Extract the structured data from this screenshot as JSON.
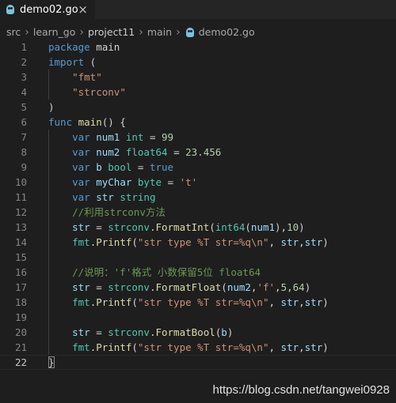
{
  "tab": {
    "filename": "demo02.go",
    "close_symbol": "×"
  },
  "breadcrumbs": [
    "src",
    "learn_go",
    "project11",
    "main",
    "demo02.go"
  ],
  "active_line": 22,
  "lines": [
    [
      [
        "k",
        "package"
      ],
      [
        "p",
        " main"
      ]
    ],
    [
      [
        "k",
        "import"
      ],
      [
        "p",
        " ("
      ]
    ],
    [
      [
        "p",
        "    "
      ],
      [
        "s",
        "\"fmt\""
      ]
    ],
    [
      [
        "p",
        "    "
      ],
      [
        "s",
        "\"strconv\""
      ]
    ],
    [
      [
        "p",
        ")"
      ]
    ],
    [
      [
        "k",
        "func"
      ],
      [
        "p",
        " "
      ],
      [
        "f",
        "main"
      ],
      [
        "p",
        "() {"
      ]
    ],
    [
      [
        "p",
        "    "
      ],
      [
        "k",
        "var"
      ],
      [
        "p",
        " "
      ],
      [
        "v",
        "num1"
      ],
      [
        "p",
        " "
      ],
      [
        "t",
        "int"
      ],
      [
        "p",
        " = "
      ],
      [
        "n",
        "99"
      ]
    ],
    [
      [
        "p",
        "    "
      ],
      [
        "k",
        "var"
      ],
      [
        "p",
        " "
      ],
      [
        "v",
        "num2"
      ],
      [
        "p",
        " "
      ],
      [
        "t",
        "float64"
      ],
      [
        "p",
        " = "
      ],
      [
        "n",
        "23.456"
      ]
    ],
    [
      [
        "p",
        "    "
      ],
      [
        "k",
        "var"
      ],
      [
        "p",
        " "
      ],
      [
        "v",
        "b"
      ],
      [
        "p",
        " "
      ],
      [
        "t",
        "bool"
      ],
      [
        "p",
        " = "
      ],
      [
        "k",
        "true"
      ]
    ],
    [
      [
        "p",
        "    "
      ],
      [
        "k",
        "var"
      ],
      [
        "p",
        " "
      ],
      [
        "v",
        "myChar"
      ],
      [
        "p",
        " "
      ],
      [
        "t",
        "byte"
      ],
      [
        "p",
        " = "
      ],
      [
        "s",
        "'t'"
      ]
    ],
    [
      [
        "p",
        "    "
      ],
      [
        "k",
        "var"
      ],
      [
        "p",
        " "
      ],
      [
        "v",
        "str"
      ],
      [
        "p",
        " "
      ],
      [
        "t",
        "string"
      ]
    ],
    [
      [
        "p",
        "    "
      ],
      [
        "c",
        "//利用strconv方法"
      ]
    ],
    [
      [
        "p",
        "    "
      ],
      [
        "v",
        "str"
      ],
      [
        "p",
        " = "
      ],
      [
        "t",
        "strconv"
      ],
      [
        "p",
        "."
      ],
      [
        "f",
        "FormatInt"
      ],
      [
        "p",
        "("
      ],
      [
        "t",
        "int64"
      ],
      [
        "p",
        "("
      ],
      [
        "v",
        "num1"
      ],
      [
        "p",
        "),"
      ],
      [
        "n",
        "10"
      ],
      [
        "p",
        ")"
      ]
    ],
    [
      [
        "p",
        "    "
      ],
      [
        "t",
        "fmt"
      ],
      [
        "p",
        "."
      ],
      [
        "f",
        "Printf"
      ],
      [
        "p",
        "("
      ],
      [
        "s",
        "\"str type %T str=%q\\n\""
      ],
      [
        "p",
        ", "
      ],
      [
        "v",
        "str"
      ],
      [
        "p",
        ","
      ],
      [
        "v",
        "str"
      ],
      [
        "p",
        ")"
      ]
    ],
    [
      [
        "p",
        ""
      ]
    ],
    [
      [
        "p",
        "    "
      ],
      [
        "c",
        "//说明：'f'格式 小数保留5位 float64"
      ]
    ],
    [
      [
        "p",
        "    "
      ],
      [
        "v",
        "str"
      ],
      [
        "p",
        " = "
      ],
      [
        "t",
        "strconv"
      ],
      [
        "p",
        "."
      ],
      [
        "f",
        "FormatFloat"
      ],
      [
        "p",
        "("
      ],
      [
        "v",
        "num2"
      ],
      [
        "p",
        ","
      ],
      [
        "s",
        "'f'"
      ],
      [
        "p",
        ","
      ],
      [
        "n",
        "5"
      ],
      [
        "p",
        ","
      ],
      [
        "n",
        "64"
      ],
      [
        "p",
        ")"
      ]
    ],
    [
      [
        "p",
        "    "
      ],
      [
        "t",
        "fmt"
      ],
      [
        "p",
        "."
      ],
      [
        "f",
        "Printf"
      ],
      [
        "p",
        "("
      ],
      [
        "s",
        "\"str type %T str=%q\\n\""
      ],
      [
        "p",
        ", "
      ],
      [
        "v",
        "str"
      ],
      [
        "p",
        ","
      ],
      [
        "v",
        "str"
      ],
      [
        "p",
        ")"
      ]
    ],
    [
      [
        "p",
        ""
      ]
    ],
    [
      [
        "p",
        "    "
      ],
      [
        "v",
        "str"
      ],
      [
        "p",
        " = "
      ],
      [
        "t",
        "strconv"
      ],
      [
        "p",
        "."
      ],
      [
        "f",
        "FormatBool"
      ],
      [
        "p",
        "("
      ],
      [
        "v",
        "b"
      ],
      [
        "p",
        ")"
      ]
    ],
    [
      [
        "p",
        "    "
      ],
      [
        "t",
        "fmt"
      ],
      [
        "p",
        "."
      ],
      [
        "f",
        "Printf"
      ],
      [
        "p",
        "("
      ],
      [
        "s",
        "\"str type %T str=%q\\n\""
      ],
      [
        "p",
        ", "
      ],
      [
        "v",
        "str"
      ],
      [
        "p",
        ","
      ],
      [
        "v",
        "str"
      ],
      [
        "p",
        ")"
      ]
    ],
    [
      [
        "p",
        "}"
      ]
    ]
  ],
  "watermark": "https://blog.csdn.net/tangwei0928",
  "colors": {
    "keyword": "#569cd6",
    "string": "#ce9178",
    "function": "#dcdcaa",
    "type": "#4ec9b0",
    "number": "#b5cea8",
    "variable": "#9cdcfe",
    "comment": "#6a9955",
    "background": "#1e1e1e"
  },
  "icons": {
    "file_icon": "gopher-icon",
    "close_icon": "close-icon",
    "separator_icon": "chevron-right-icon"
  }
}
